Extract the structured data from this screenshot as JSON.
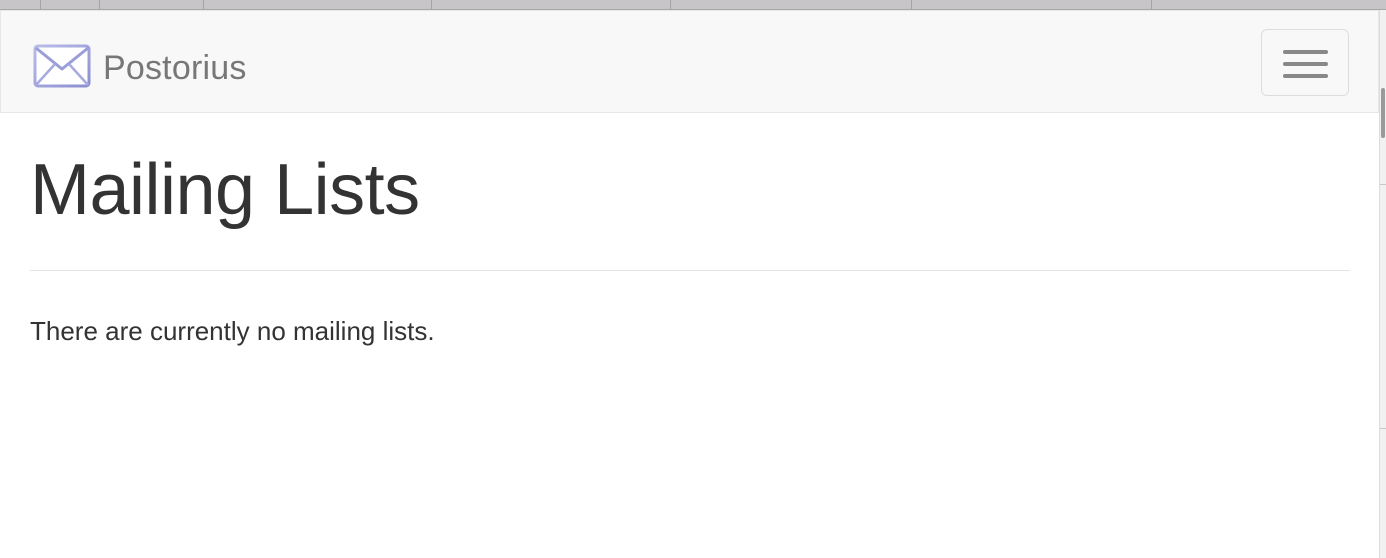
{
  "browser": {
    "tab_count": 7
  },
  "navbar": {
    "brand_name": "Postorius",
    "brand_icon": "envelope-icon",
    "toggle_icon": "hamburger-icon",
    "background": "#f8f8f8"
  },
  "main": {
    "title": "Mailing Lists",
    "empty_message": "There are currently no mailing lists."
  },
  "colors": {
    "text": "#333333",
    "brand_text": "#777777",
    "logo_accent": "#8c8fd1"
  }
}
